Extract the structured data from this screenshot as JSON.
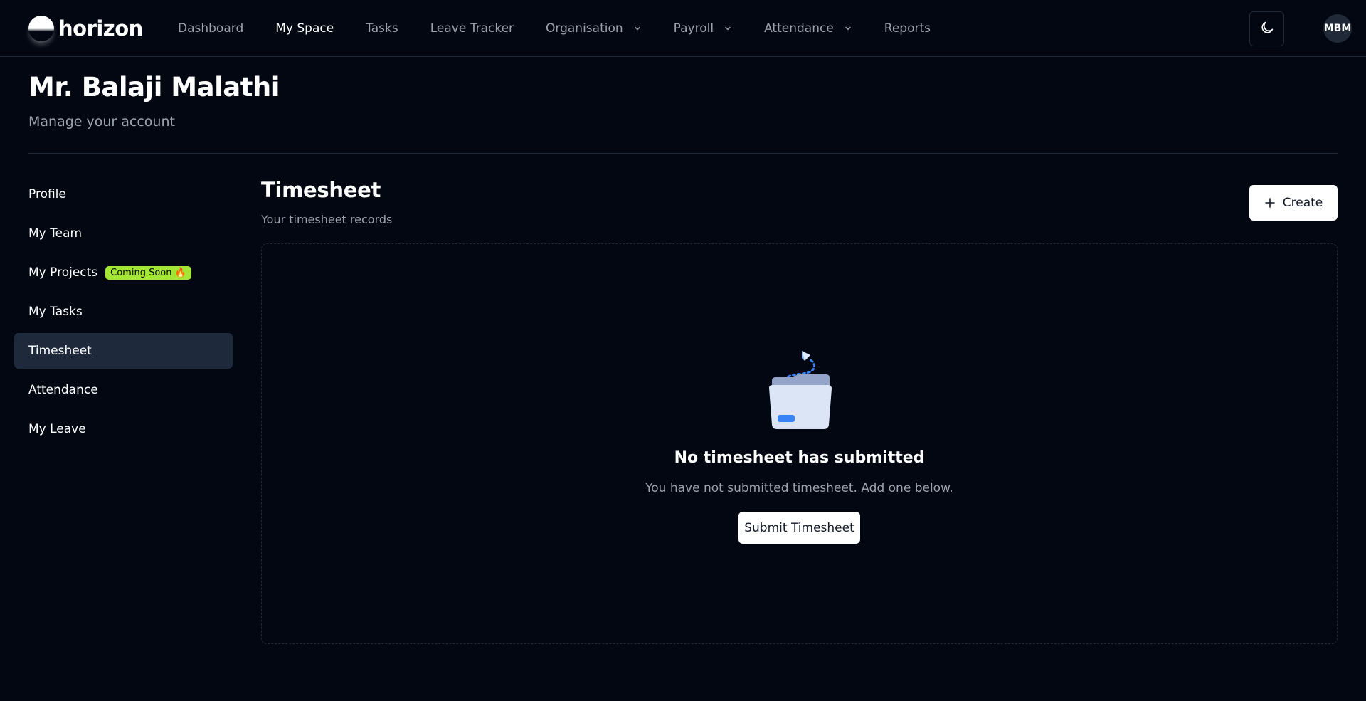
{
  "app": {
    "logo_text": "horizon"
  },
  "nav": {
    "items": [
      {
        "label": "Dashboard"
      },
      {
        "label": "My Space"
      },
      {
        "label": "Tasks"
      },
      {
        "label": "Leave Tracker"
      },
      {
        "label": "Organisation"
      },
      {
        "label": "Payroll"
      },
      {
        "label": "Attendance"
      },
      {
        "label": "Reports"
      }
    ],
    "theme_icon": "moon-icon",
    "avatar_initials": "MBM"
  },
  "header": {
    "title": "Mr. Balaji Malathi",
    "subtitle": "Manage your account"
  },
  "sidebar": {
    "items": [
      {
        "label": "Profile"
      },
      {
        "label": "My Team"
      },
      {
        "label": "My Projects",
        "badge": "Coming Soon 🔥"
      },
      {
        "label": "My Tasks"
      },
      {
        "label": "Timesheet"
      },
      {
        "label": "Attendance"
      },
      {
        "label": "My Leave"
      }
    ],
    "active": "Timesheet"
  },
  "main": {
    "title": "Timesheet",
    "subtitle": "Your timesheet records",
    "create_label": "Create",
    "empty_state": {
      "icon": "empty-folder-icon",
      "title": "No timesheet has submitted",
      "description": "You have not submitted timesheet. Add one below.",
      "button_label": "Submit Timesheet"
    }
  },
  "colors": {
    "background": "#030712",
    "border": "#1f2937",
    "active_item": "#1e293b",
    "badge": "#a3e635",
    "muted_text": "#9ca3af",
    "accent_blue": "#3b82f6"
  }
}
